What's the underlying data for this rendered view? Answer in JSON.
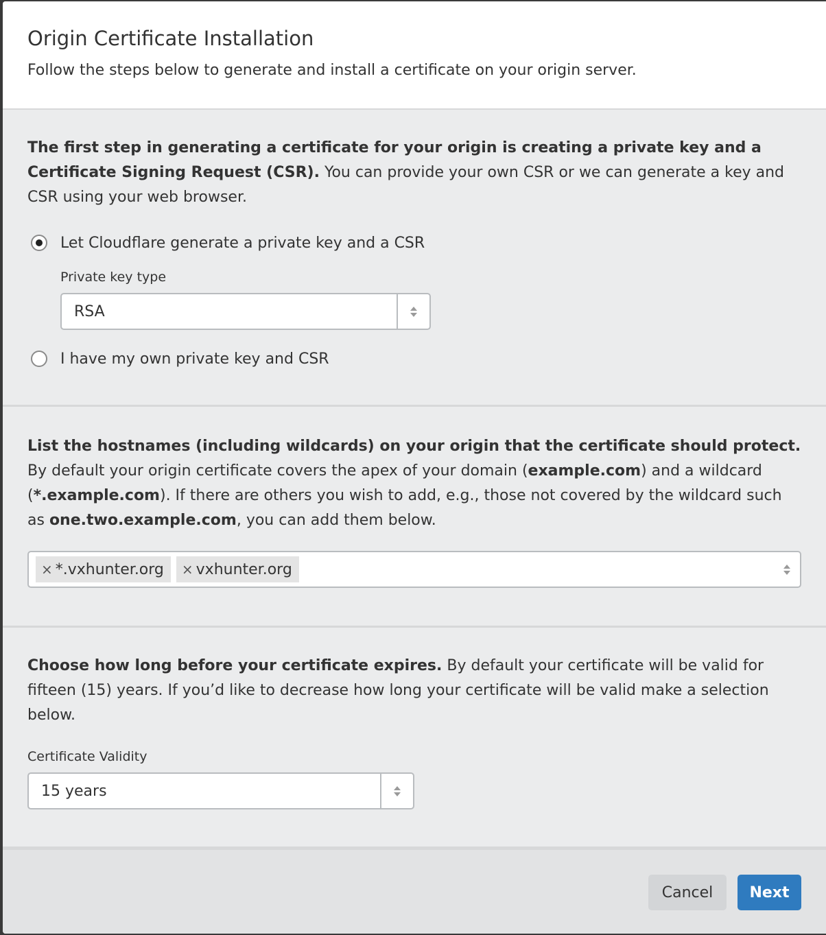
{
  "modal": {
    "title": "Origin Certificate Installation",
    "subtitle": "Follow the steps below to generate and install a certificate on your origin server."
  },
  "step_key": {
    "intro_bold": "The first step in generating a certificate for your origin is creating a private key and a Certificate Signing Request (CSR).",
    "intro_rest": " You can provide your own CSR or we can generate a key and CSR using your web browser.",
    "option_generate": "Let Cloudflare generate a private key and a CSR",
    "option_generate_selected": true,
    "key_type_label": "Private key type",
    "key_type_value": "RSA",
    "option_own": "I have my own private key and CSR"
  },
  "step_hosts": {
    "bold": "List the hostnames (including wildcards) on your origin that the certificate should protect.",
    "t1": " By default your origin certificate covers the apex of your domain (",
    "b1": "example.com",
    "t2": ") and a wildcard (",
    "b2": "*.example.com",
    "t3": "). If there are others you wish to add, e.g., those not covered by the wildcard such as ",
    "b3": "one.two.example.com",
    "t4": ", you can add them below.",
    "tags": [
      {
        "label": "*.vxhunter.org",
        "remove": "×"
      },
      {
        "label": "vxhunter.org",
        "remove": "×"
      }
    ]
  },
  "step_validity": {
    "bold": "Choose how long before your certificate expires.",
    "rest": " By default your certificate will be valid for fifteen (15) years. If you’d like to decrease how long your certificate will be valid make a selection below.",
    "label": "Certificate Validity",
    "value": "15 years"
  },
  "footer": {
    "cancel": "Cancel",
    "next": "Next"
  },
  "colors": {
    "primary": "#2f7bbf",
    "panel": "#ebeced",
    "footer": "#e2e3e4"
  }
}
